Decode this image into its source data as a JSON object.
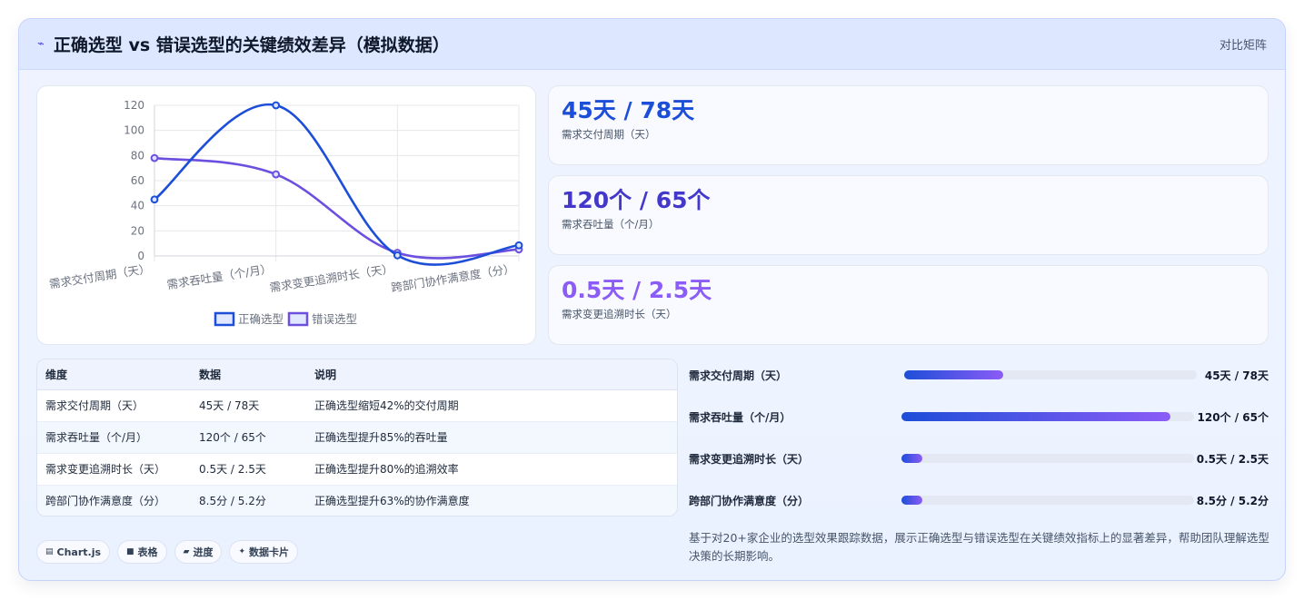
{
  "header": {
    "title": "正确选型 vs 错误选型的关键绩效差异（模拟数据）",
    "tag": "对比矩阵"
  },
  "chart_data": {
    "type": "line",
    "categories": [
      "需求交付周期（天）",
      "需求吞吐量（个/月）",
      "需求变更追溯时长（天）",
      "跨部门协作满意度（分）"
    ],
    "series": [
      {
        "name": "正确选型",
        "values": [
          45,
          120,
          0.5,
          8.5
        ],
        "color": "#1d4ed8"
      },
      {
        "name": "错误选型",
        "values": [
          78,
          65,
          2.5,
          5.2
        ],
        "color": "#6d4fe0"
      }
    ],
    "ylim": [
      0,
      120
    ],
    "yticks": [
      0,
      20,
      40,
      60,
      80,
      100,
      120
    ],
    "grid": true,
    "legend": "bottom"
  },
  "stats": [
    {
      "value": "45天 / 78天",
      "label": "需求交付周期（天）",
      "color": "#1d4ed8"
    },
    {
      "value": "120个 / 65个",
      "label": "需求吞吐量（个/月）",
      "color": "#4338ca"
    },
    {
      "value": "0.5天 / 2.5天",
      "label": "需求变更追溯时长（天）",
      "color": "#8b5cf6"
    }
  ],
  "table": {
    "headers": [
      "维度",
      "数据",
      "说明"
    ],
    "rows": [
      [
        "需求交付周期（天）",
        "45天 / 78天",
        "正确选型缩短42%的交付周期"
      ],
      [
        "需求吞吐量（个/月）",
        "120个 / 65个",
        "正确选型提升85%的吞吐量"
      ],
      [
        "需求变更追溯时长（天）",
        "0.5天 / 2.5天",
        "正确选型提升80%的追溯效率"
      ],
      [
        "跨部门协作满意度（分）",
        "8.5分 / 5.2分",
        "正确选型提升63%的协作满意度"
      ]
    ]
  },
  "progress": [
    {
      "label": "需求交付周期（天）",
      "value": "45天 / 78天",
      "fill": 0.34
    },
    {
      "label": "需求吞吐量（个/月）",
      "value": "120个 / 65个",
      "fill": 0.92
    },
    {
      "label": "需求变更追溯时长（天）",
      "value": "0.5天 / 2.5天",
      "fill": 0.07
    },
    {
      "label": "跨部门协作满意度（分）",
      "value": "8.5分 / 5.2分",
      "fill": 0.07
    }
  ],
  "summary": "基于对20+家企业的选型效果跟踪数据，展示正确选型与错误选型在关键绩效指标上的显著差异，帮助团队理解选型决策的长期影响。",
  "chips": [
    {
      "icon": "chart-icon",
      "label": "Chart.js"
    },
    {
      "icon": "table-icon",
      "label": "表格"
    },
    {
      "icon": "progress-icon",
      "label": "进度"
    },
    {
      "icon": "sparkle-icon",
      "label": "数据卡片"
    }
  ]
}
